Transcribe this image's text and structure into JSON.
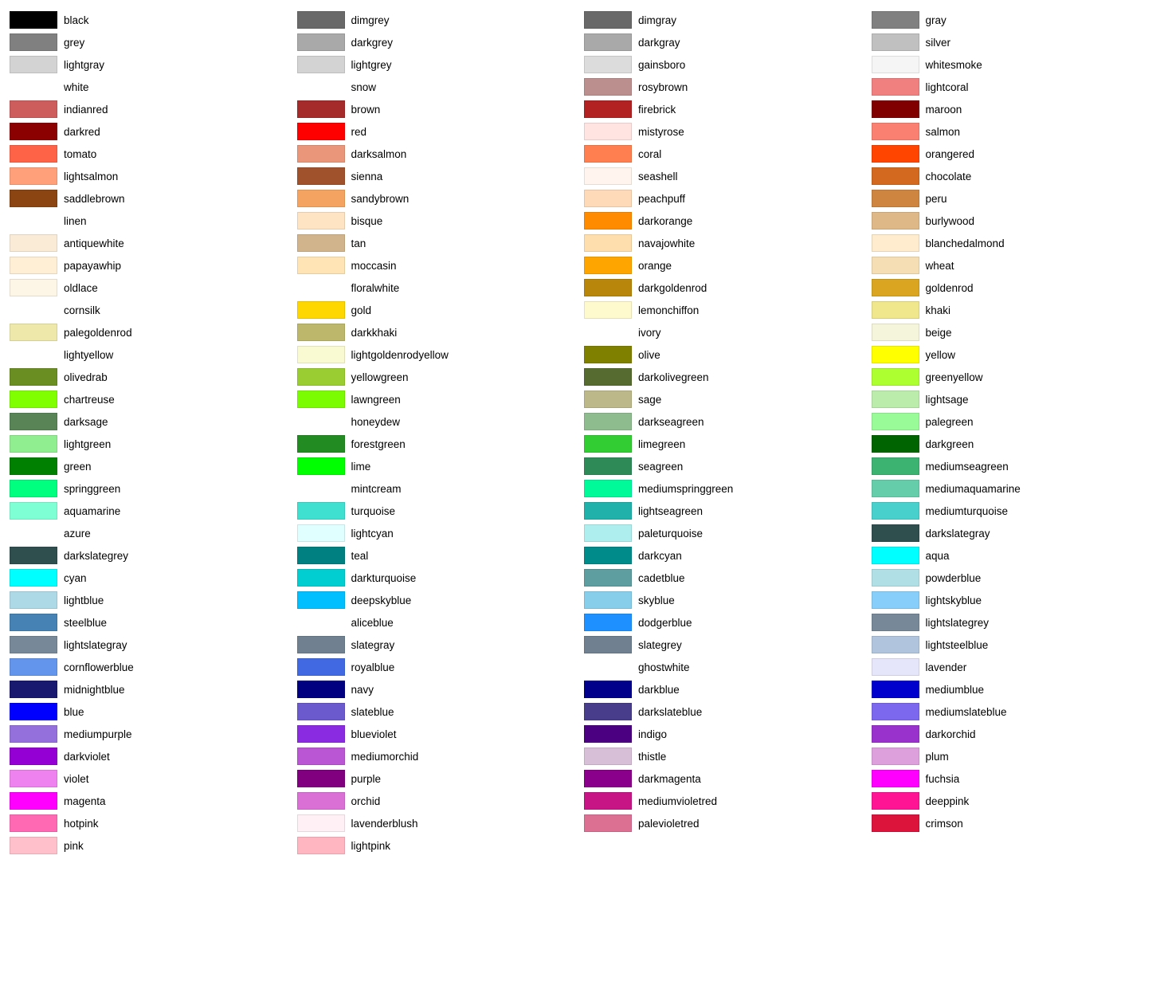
{
  "columns": [
    {
      "id": "col1",
      "items": [
        {
          "name": "black",
          "color": "#000000"
        },
        {
          "name": "grey",
          "color": "#808080"
        },
        {
          "name": "lightgray",
          "color": "#D3D3D3"
        },
        {
          "name": "white",
          "color": null
        },
        {
          "name": "indianred",
          "color": "#CD5C5C"
        },
        {
          "name": "darkred",
          "color": "#8B0000"
        },
        {
          "name": "tomato",
          "color": "#FF6347"
        },
        {
          "name": "lightsalmon",
          "color": "#FFA07A"
        },
        {
          "name": "saddlebrown",
          "color": "#8B4513"
        },
        {
          "name": "linen",
          "color": null
        },
        {
          "name": "antiquewhite",
          "color": "#FAEBD7"
        },
        {
          "name": "papayawhip",
          "color": "#FFEFD5"
        },
        {
          "name": "oldlace",
          "color": "#FDF5E6"
        },
        {
          "name": "cornsilk",
          "color": null
        },
        {
          "name": "palegoldenrod",
          "color": "#EEE8AA"
        },
        {
          "name": "lightyellow",
          "color": null
        },
        {
          "name": "olivedrab",
          "color": "#6B8E23"
        },
        {
          "name": "chartreuse",
          "color": "#7FFF00"
        },
        {
          "name": "darksage",
          "color": "#598556"
        },
        {
          "name": "lightgreen",
          "color": "#90EE90"
        },
        {
          "name": "green",
          "color": "#008000"
        },
        {
          "name": "springgreen",
          "color": "#00FF7F"
        },
        {
          "name": "aquamarine",
          "color": "#7FFFD4"
        },
        {
          "name": "azure",
          "color": null
        },
        {
          "name": "darkslategrey",
          "color": "#2F4F4F"
        },
        {
          "name": "cyan",
          "color": "#00FFFF"
        },
        {
          "name": "lightblue",
          "color": "#ADD8E6"
        },
        {
          "name": "steelblue",
          "color": "#4682B4"
        },
        {
          "name": "lightslategray",
          "color": "#778899"
        },
        {
          "name": "cornflowerblue",
          "color": "#6495ED"
        },
        {
          "name": "midnightblue",
          "color": "#191970"
        },
        {
          "name": "blue",
          "color": "#0000FF"
        },
        {
          "name": "mediumpurple",
          "color": "#9370DB"
        },
        {
          "name": "darkviolet",
          "color": "#9400D3"
        },
        {
          "name": "violet",
          "color": "#EE82EE"
        },
        {
          "name": "magenta",
          "color": "#FF00FF"
        },
        {
          "name": "hotpink",
          "color": "#FF69B4"
        },
        {
          "name": "pink",
          "color": "#FFC0CB"
        }
      ]
    },
    {
      "id": "col2",
      "items": [
        {
          "name": "dimgrey",
          "color": "#696969"
        },
        {
          "name": "darkgrey",
          "color": "#A9A9A9"
        },
        {
          "name": "lightgrey",
          "color": "#D3D3D3"
        },
        {
          "name": "snow",
          "color": null
        },
        {
          "name": "brown",
          "color": "#A52A2A"
        },
        {
          "name": "red",
          "color": "#FF0000"
        },
        {
          "name": "darksalmon",
          "color": "#E9967A"
        },
        {
          "name": "sienna",
          "color": "#A0522D"
        },
        {
          "name": "sandybrown",
          "color": "#F4A460"
        },
        {
          "name": "bisque",
          "color": "#FFE4C4"
        },
        {
          "name": "tan",
          "color": "#D2B48C"
        },
        {
          "name": "moccasin",
          "color": "#FFE4B5"
        },
        {
          "name": "floralwhite",
          "color": null
        },
        {
          "name": "gold",
          "color": "#FFD700"
        },
        {
          "name": "darkkhaki",
          "color": "#BDB76B"
        },
        {
          "name": "lightgoldenrodyellow",
          "color": "#FAFAD2"
        },
        {
          "name": "yellowgreen",
          "color": "#9ACD32"
        },
        {
          "name": "lawngreen",
          "color": "#7CFC00"
        },
        {
          "name": "honeydew",
          "color": null
        },
        {
          "name": "forestgreen",
          "color": "#228B22"
        },
        {
          "name": "lime",
          "color": "#00FF00"
        },
        {
          "name": "mintcream",
          "color": null
        },
        {
          "name": "turquoise",
          "color": "#40E0D0"
        },
        {
          "name": "lightcyan",
          "color": "#E0FFFF"
        },
        {
          "name": "teal",
          "color": "#008080"
        },
        {
          "name": "darkturquoise",
          "color": "#00CED1"
        },
        {
          "name": "deepskyblue",
          "color": "#00BFFF"
        },
        {
          "name": "aliceblue",
          "color": null
        },
        {
          "name": "slategray",
          "color": "#708090"
        },
        {
          "name": "royalblue",
          "color": "#4169E1"
        },
        {
          "name": "navy",
          "color": "#000080"
        },
        {
          "name": "slateblue",
          "color": "#6A5ACD"
        },
        {
          "name": "blueviolet",
          "color": "#8A2BE2"
        },
        {
          "name": "mediumorchid",
          "color": "#BA55D3"
        },
        {
          "name": "purple",
          "color": "#800080"
        },
        {
          "name": "orchid",
          "color": "#DA70D6"
        },
        {
          "name": "lavenderblush",
          "color": "#FFF0F5"
        },
        {
          "name": "lightpink",
          "color": "#FFB6C1"
        }
      ]
    },
    {
      "id": "col3",
      "items": [
        {
          "name": "dimgray",
          "color": "#696969"
        },
        {
          "name": "darkgray",
          "color": "#A9A9A9"
        },
        {
          "name": "gainsboro",
          "color": "#DCDCDC"
        },
        {
          "name": "rosybrown",
          "color": "#BC8F8F"
        },
        {
          "name": "firebrick",
          "color": "#B22222"
        },
        {
          "name": "mistyrose",
          "color": "#FFE4E1"
        },
        {
          "name": "coral",
          "color": "#FF7F50"
        },
        {
          "name": "seashell",
          "color": "#FFF5EE"
        },
        {
          "name": "peachpuff",
          "color": "#FFDAB9"
        },
        {
          "name": "darkorange",
          "color": "#FF8C00"
        },
        {
          "name": "navajowhite",
          "color": "#FFDEAD"
        },
        {
          "name": "orange",
          "color": "#FFA500"
        },
        {
          "name": "darkgoldenrod",
          "color": "#B8860B"
        },
        {
          "name": "lemonchiffon",
          "color": "#FFFACD"
        },
        {
          "name": "ivory",
          "color": null
        },
        {
          "name": "olive",
          "color": "#808000"
        },
        {
          "name": "darkolivegreen",
          "color": "#556B2F"
        },
        {
          "name": "sage",
          "color": "#BCB88A"
        },
        {
          "name": "darkseagreen",
          "color": "#8FBC8F"
        },
        {
          "name": "limegreen",
          "color": "#32CD32"
        },
        {
          "name": "seagreen",
          "color": "#2E8B57"
        },
        {
          "name": "mediumspringgreen",
          "color": "#00FA9A"
        },
        {
          "name": "lightseagreen",
          "color": "#20B2AA"
        },
        {
          "name": "paleturquoise",
          "color": "#AFEEEE"
        },
        {
          "name": "darkcyan",
          "color": "#008B8B"
        },
        {
          "name": "cadetblue",
          "color": "#5F9EA0"
        },
        {
          "name": "skyblue",
          "color": "#87CEEB"
        },
        {
          "name": "dodgerblue",
          "color": "#1E90FF"
        },
        {
          "name": "slategrey",
          "color": "#708090"
        },
        {
          "name": "ghostwhite",
          "color": null
        },
        {
          "name": "darkblue",
          "color": "#00008B"
        },
        {
          "name": "darkslateblue",
          "color": "#483D8B"
        },
        {
          "name": "indigo",
          "color": "#4B0082"
        },
        {
          "name": "thistle",
          "color": "#D8BFD8"
        },
        {
          "name": "darkmagenta",
          "color": "#8B008B"
        },
        {
          "name": "mediumvioletred",
          "color": "#C71585"
        },
        {
          "name": "palevioletred",
          "color": "#DB7093"
        }
      ]
    },
    {
      "id": "col4",
      "items": [
        {
          "name": "gray",
          "color": "#808080"
        },
        {
          "name": "silver",
          "color": "#C0C0C0"
        },
        {
          "name": "whitesmoke",
          "color": "#F5F5F5"
        },
        {
          "name": "lightcoral",
          "color": "#F08080"
        },
        {
          "name": "maroon",
          "color": "#800000"
        },
        {
          "name": "salmon",
          "color": "#FA8072"
        },
        {
          "name": "orangered",
          "color": "#FF4500"
        },
        {
          "name": "chocolate",
          "color": "#D2691E"
        },
        {
          "name": "peru",
          "color": "#CD853F"
        },
        {
          "name": "burlywood",
          "color": "#DEB887"
        },
        {
          "name": "blanchedalmond",
          "color": "#FFEBCD"
        },
        {
          "name": "wheat",
          "color": "#F5DEB3"
        },
        {
          "name": "goldenrod",
          "color": "#DAA520"
        },
        {
          "name": "khaki",
          "color": "#F0E68C"
        },
        {
          "name": "beige",
          "color": "#F5F5DC"
        },
        {
          "name": "yellow",
          "color": "#FFFF00"
        },
        {
          "name": "greenyellow",
          "color": "#ADFF2F"
        },
        {
          "name": "lightsage",
          "color": "#BCECAC"
        },
        {
          "name": "palegreen",
          "color": "#98FB98"
        },
        {
          "name": "darkgreen",
          "color": "#006400"
        },
        {
          "name": "mediumseagreen",
          "color": "#3CB371"
        },
        {
          "name": "mediumaquamarine",
          "color": "#66CDAA"
        },
        {
          "name": "mediumturquoise",
          "color": "#48D1CC"
        },
        {
          "name": "darkslategray",
          "color": "#2F4F4F"
        },
        {
          "name": "aqua",
          "color": "#00FFFF"
        },
        {
          "name": "powderblue",
          "color": "#B0E0E6"
        },
        {
          "name": "lightskyblue",
          "color": "#87CEFA"
        },
        {
          "name": "lightslategrey",
          "color": "#778899"
        },
        {
          "name": "lightsteelblue",
          "color": "#B0C4DE"
        },
        {
          "name": "lavender",
          "color": "#E6E6FA"
        },
        {
          "name": "mediumblue",
          "color": "#0000CD"
        },
        {
          "name": "mediumslateblue",
          "color": "#7B68EE"
        },
        {
          "name": "darkorchid",
          "color": "#9932CC"
        },
        {
          "name": "plum",
          "color": "#DDA0DD"
        },
        {
          "name": "fuchsia",
          "color": "#FF00FF"
        },
        {
          "name": "deeppink",
          "color": "#FF1493"
        },
        {
          "name": "crimson",
          "color": "#DC143C"
        }
      ]
    }
  ]
}
